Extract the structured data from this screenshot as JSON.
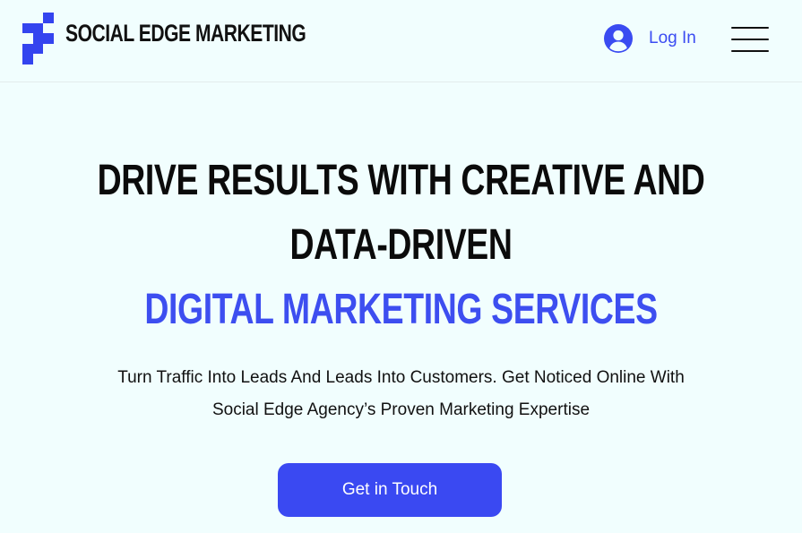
{
  "header": {
    "brand_name": "SOCIAL EDGE MARKETING",
    "login_label": "Log In"
  },
  "hero": {
    "headline_line1": "DRIVE RESULTS WITH CREATIVE AND",
    "headline_line2": "DATA-DRIVEN",
    "headline_line3": "DIGITAL MARKETING SERVICES",
    "subtitle_line1": "Turn Traffic Into Leads And Leads Into Customers. Get Noticed Online With",
    "subtitle_line2": "Social Edge Agency’s Proven Marketing Expertise",
    "cta_label": "Get in Touch"
  },
  "colors": {
    "background": "#f1fefe",
    "accent": "#3d4ef0",
    "text": "#111111"
  },
  "icons": {
    "logo": "pixel-logo-icon",
    "user": "user-circle-icon",
    "menu": "hamburger-menu-icon"
  }
}
